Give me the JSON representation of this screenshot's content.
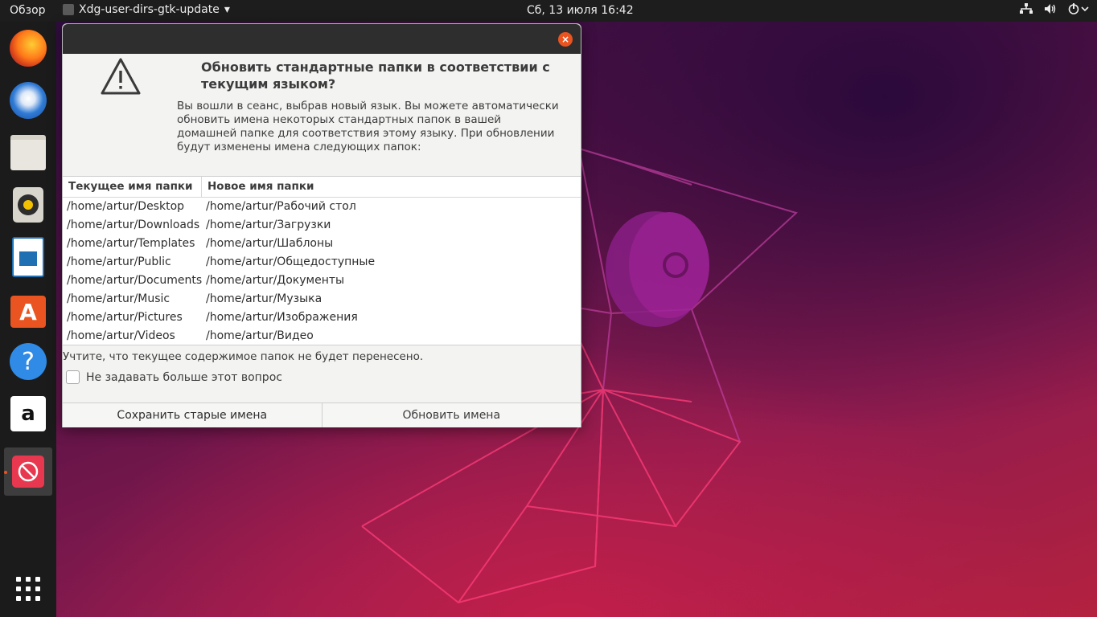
{
  "topbar": {
    "activities_label": "Обзор",
    "app_name": "Xdg-user-dirs-gtk-update",
    "app_menu_arrow": "▾",
    "clock": "Сб, 13 июля  16:42",
    "tray_icons": [
      "network-icon",
      "volume-icon",
      "power-icon"
    ]
  },
  "dock": {
    "items": [
      "firefox",
      "thunderbird",
      "files",
      "rhythmbox",
      "libreoffice-writer",
      "ubuntu-software",
      "help",
      "amazon",
      "xdg-user-dirs-gtk-update"
    ],
    "show_apps_icon": "grid-icon"
  },
  "dialog": {
    "close_glyph": "×",
    "icon": "warning-icon",
    "heading": "Обновить стандартные папки в соответствии с текущим языком?",
    "description": "Вы вошли в сеанс, выбрав новый язык. Вы можете автоматически обновить имена некоторых стандартных папок в вашей домашней папке для соответствия этому языку. При обновлении будут изменены имена следующих папок:",
    "table": {
      "headers": [
        "Текущее имя папки",
        "Новое имя папки"
      ],
      "rows": [
        [
          "/home/artur/Desktop",
          "/home/artur/Рабочий стол"
        ],
        [
          "/home/artur/Downloads",
          "/home/artur/Загрузки"
        ],
        [
          "/home/artur/Templates",
          "/home/artur/Шаблоны"
        ],
        [
          "/home/artur/Public",
          "/home/artur/Общедоступные"
        ],
        [
          "/home/artur/Documents",
          "/home/artur/Документы"
        ],
        [
          "/home/artur/Music",
          "/home/artur/Музыка"
        ],
        [
          "/home/artur/Pictures",
          "/home/artur/Изображения"
        ],
        [
          "/home/artur/Videos",
          "/home/artur/Видео"
        ]
      ]
    },
    "note": "Учтите, что текущее содержимое папок не будет перенесено.",
    "checkbox_label": "Не задавать больше этот вопрос",
    "checkbox_checked": false,
    "buttons": {
      "keep": "Сохранить старые имена",
      "update": "Обновить имена"
    }
  },
  "colors": {
    "accent": "#e95420",
    "topbar": "#1d1d1d",
    "dock": "#1b1b1b"
  }
}
